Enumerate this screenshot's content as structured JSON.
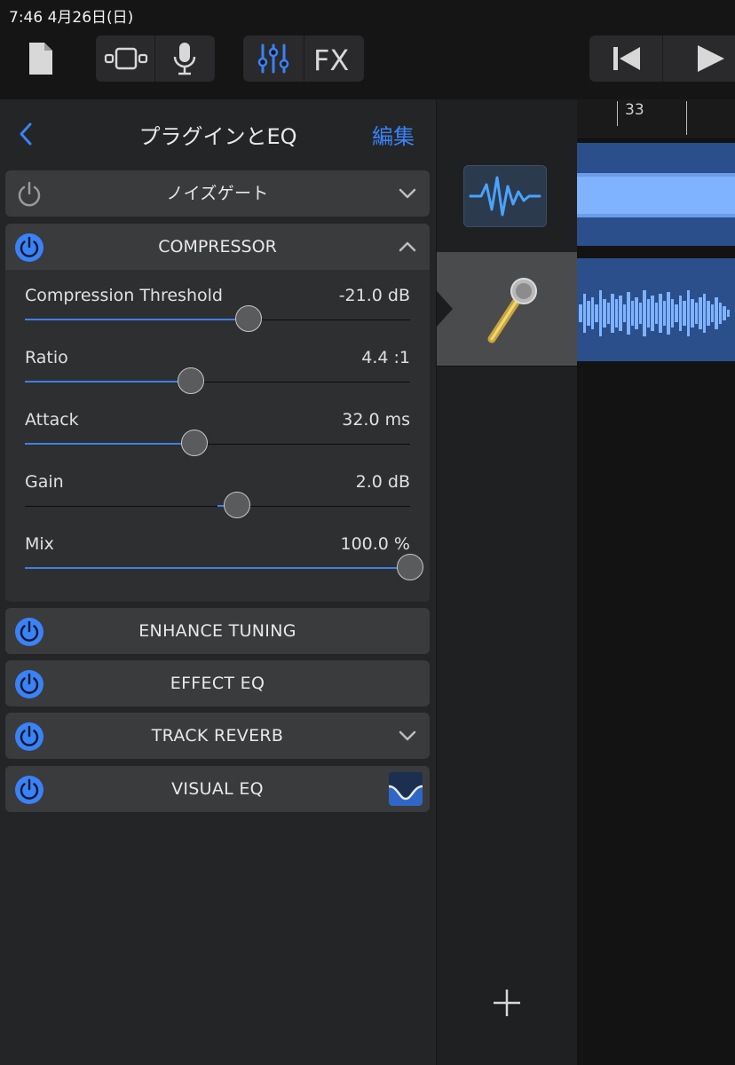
{
  "status_bar": {
    "text": "7:46   4月26日(日)"
  },
  "panel": {
    "title": "プラグインとEQ",
    "edit_label": "編集"
  },
  "plugins": [
    {
      "name": "ノイズゲート",
      "power": "off",
      "expanded": false
    },
    {
      "name": "COMPRESSOR",
      "power": "on",
      "expanded": true
    },
    {
      "name": "ENHANCE TUNING",
      "power": "on"
    },
    {
      "name": "EFFECT EQ",
      "power": "on"
    },
    {
      "name": "TRACK REVERB",
      "power": "on",
      "expanded": false
    },
    {
      "name": "VISUAL EQ",
      "power": "on"
    }
  ],
  "compressor": {
    "params": [
      {
        "label": "Compression Threshold",
        "value": "-21.0 dB",
        "level": 0.58
      },
      {
        "label": "Ratio",
        "value": "4.4 :1",
        "level": 0.43
      },
      {
        "label": "Attack",
        "value": "32.0 ms",
        "level": 0.44
      },
      {
        "label": "Gain",
        "value": "2.0 dB",
        "level": 0.55,
        "bipolar": true
      },
      {
        "label": "Mix",
        "value": "100.0 %",
        "level": 1.0
      }
    ]
  },
  "ruler": {
    "bar": "33"
  },
  "colors": {
    "accent": "#3a82f7",
    "region": "#2a4f8b",
    "waveform": "#7fb2ff"
  }
}
